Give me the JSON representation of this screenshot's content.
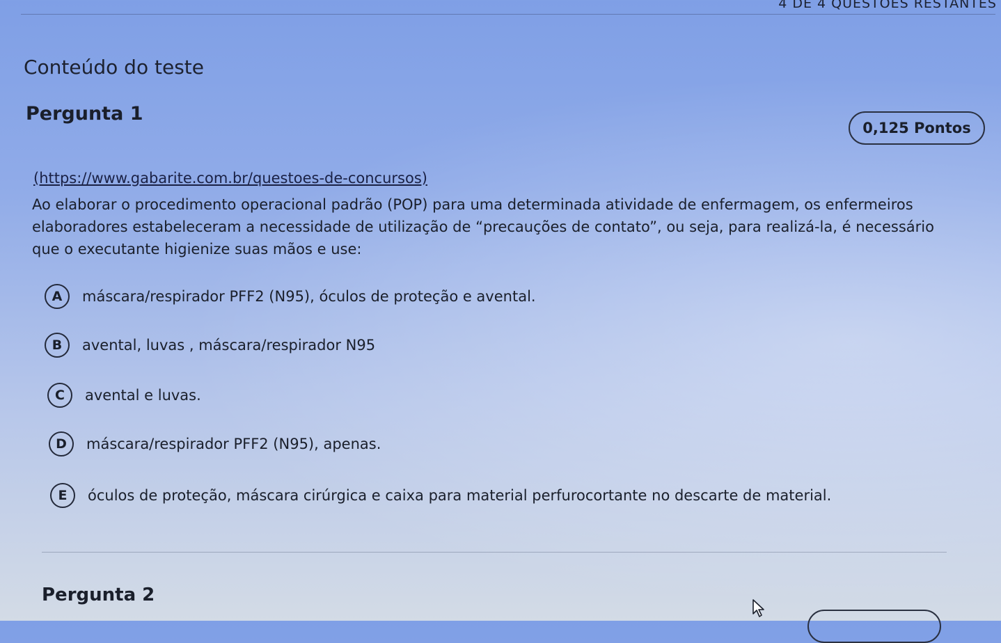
{
  "header": {
    "status": "4 DE 4 QUESTÕES RESTANTES"
  },
  "page": {
    "title": "Conteúdo do teste"
  },
  "question1": {
    "title": "Pergunta 1",
    "points": "0,125 Pontos",
    "source": "(https://www.gabarite.com.br/questoes-de-concursos)",
    "text": "Ao elaborar o procedimento operacional padrão (POP) para uma determinada atividade de enfermagem, os enfermeiros elaboradores estabeleceram a necessidade de utilização de “precauções de contato”, ou seja, para realizá-la, é necessário que o executante higienize suas mãos e use:",
    "options": [
      {
        "letter": "A",
        "text": "máscara/respirador PFF2 (N95), óculos de proteção e avental."
      },
      {
        "letter": "B",
        "text": "avental, luvas , máscara/respirador N95"
      },
      {
        "letter": "C",
        "text": "avental e luvas."
      },
      {
        "letter": "D",
        "text": "máscara/respirador PFF2 (N95), apenas."
      },
      {
        "letter": "E",
        "text": "óculos de proteção, máscara cirúrgica e caixa para material perfurocortante no descarte de material."
      }
    ]
  },
  "question2": {
    "title": "Pergunta 2"
  }
}
